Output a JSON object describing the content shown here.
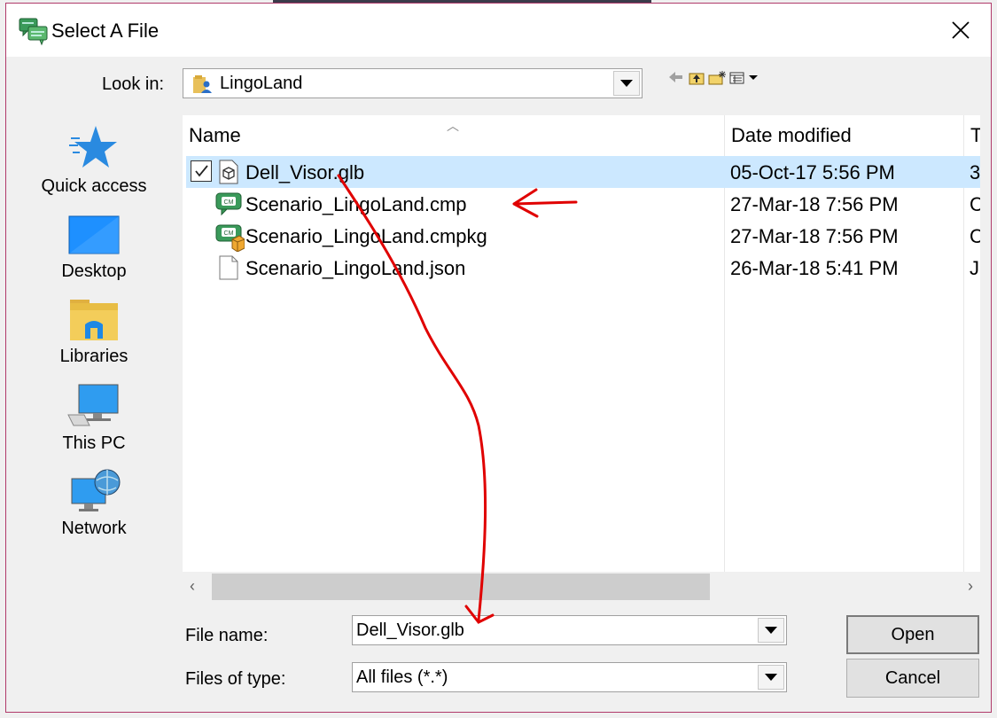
{
  "window": {
    "title": "Select A File"
  },
  "look_in": {
    "label": "Look in:",
    "value": "LingoLand"
  },
  "places": [
    {
      "label": "Quick access",
      "icon": "star-icon"
    },
    {
      "label": "Desktop",
      "icon": "desktop-icon"
    },
    {
      "label": "Libraries",
      "icon": "libraries-icon"
    },
    {
      "label": "This PC",
      "icon": "computer-icon"
    },
    {
      "label": "Network",
      "icon": "network-icon"
    }
  ],
  "columns": {
    "name": "Name",
    "date": "Date modified",
    "type": "T"
  },
  "files": [
    {
      "name": "Dell_Visor.glb",
      "date": "05-Oct-17 5:56 PM",
      "type": "3",
      "selected": true,
      "icon": "cube-file-icon"
    },
    {
      "name": "Scenario_LingoLand.cmp",
      "date": "27-Mar-18 7:56 PM",
      "type": "C",
      "selected": false,
      "icon": "cm-file-icon"
    },
    {
      "name": "Scenario_LingoLand.cmpkg",
      "date": "27-Mar-18 7:56 PM",
      "type": "C",
      "selected": false,
      "icon": "cm-package-icon"
    },
    {
      "name": "Scenario_LingoLand.json",
      "date": "26-Mar-18 5:41 PM",
      "type": "JS",
      "selected": false,
      "icon": "blank-file-icon"
    }
  ],
  "file_name": {
    "label": "File name:",
    "value": "Dell_Visor.glb"
  },
  "file_type": {
    "label": "Files of type:",
    "value": "All files (*.*)"
  },
  "buttons": {
    "open": "Open",
    "cancel": "Cancel"
  },
  "colors": {
    "selection": "#cce8ff",
    "annotation": "#e00000",
    "dialog_border": "#b03a6a"
  }
}
